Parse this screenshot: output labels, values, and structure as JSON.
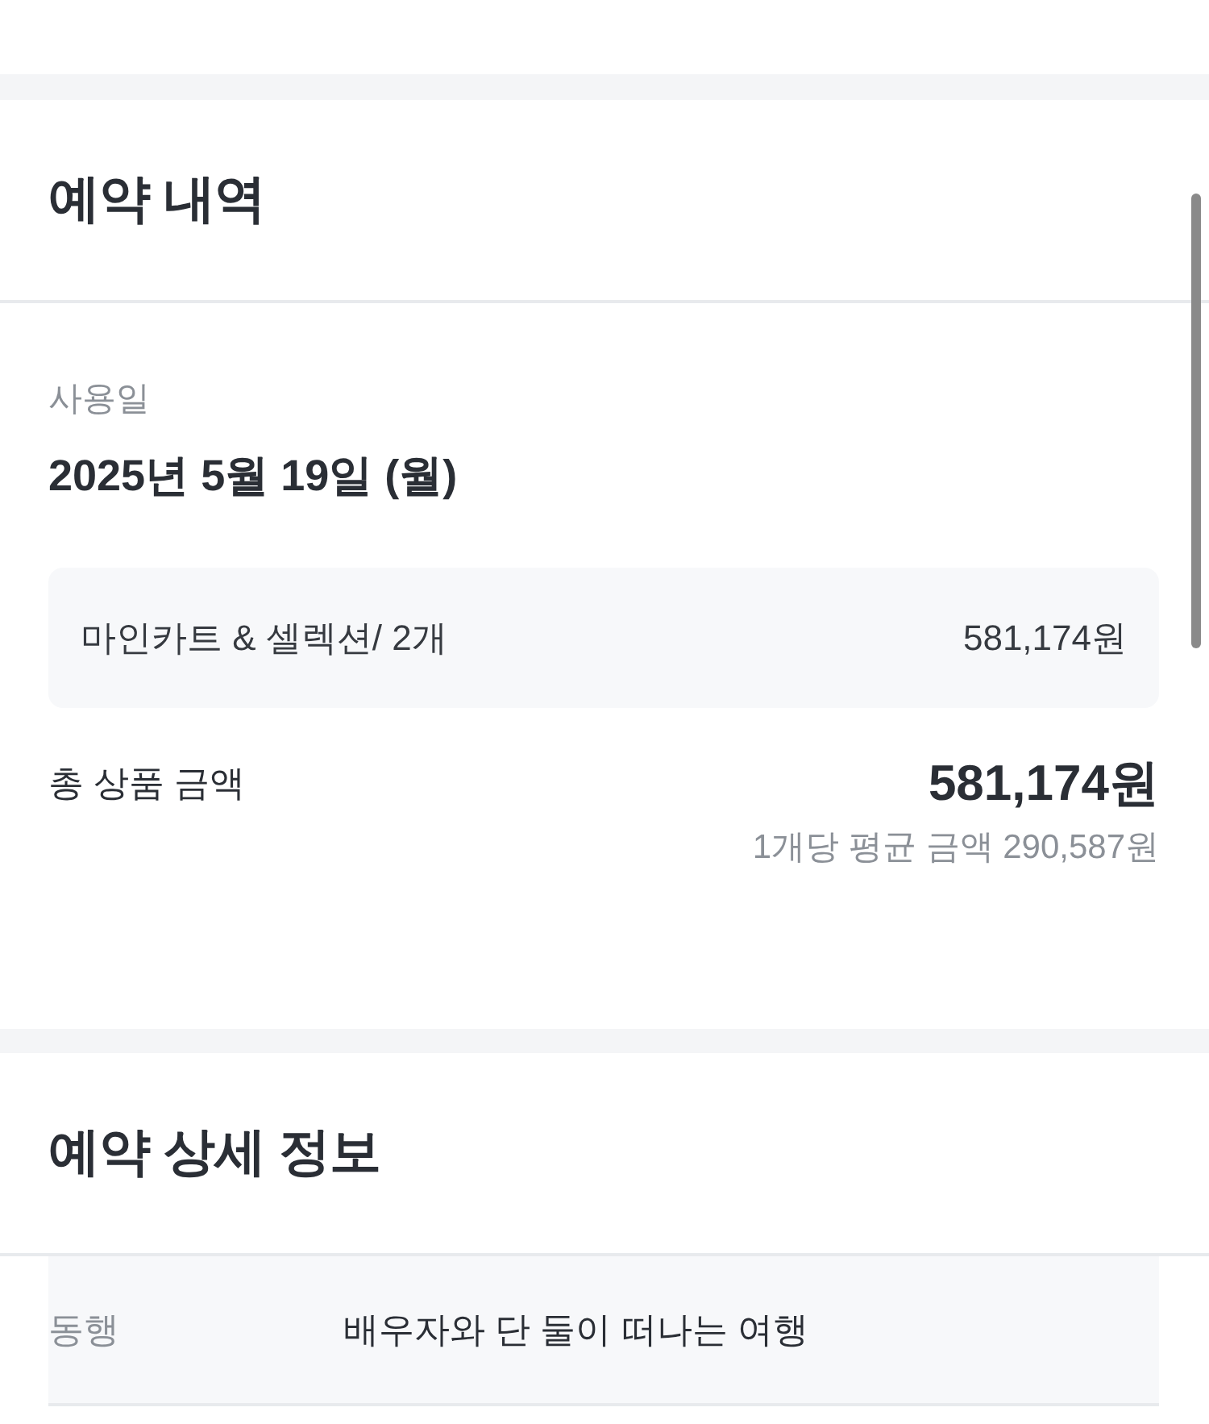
{
  "reservation": {
    "title": "예약 내역",
    "usage_date": {
      "label": "사용일",
      "value": "2025년 5월 19일 (월)"
    },
    "items": [
      {
        "name": "마인카트 & 셀렉션/ 2개",
        "price": "581,174원"
      }
    ],
    "total": {
      "label": "총 상품 금액",
      "value": "581,174원",
      "average": "1개당 평균 금액 290,587원"
    }
  },
  "details": {
    "title": "예약 상세 정보",
    "rows": [
      {
        "label": "동행",
        "value": "배우자와 단 둘이 떠나는 여행"
      }
    ]
  }
}
